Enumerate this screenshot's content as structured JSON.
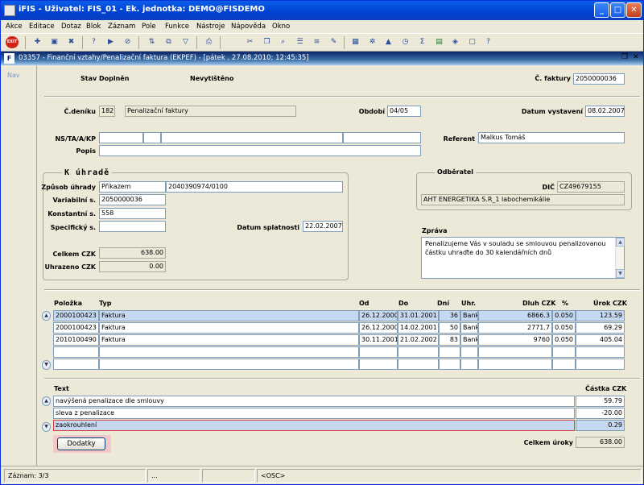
{
  "window": {
    "title": "iFIS - Uživatel: FIS_01 - Ek. jednotka: DEMO@FISDEMO",
    "controls": [
      "_",
      "□",
      "✕"
    ]
  },
  "menu": [
    "Akce",
    "Editace",
    "Dotaz",
    "Blok",
    "Záznam",
    "Pole",
    "Funkce",
    "Nástroje",
    "Nápověda",
    "Okno"
  ],
  "toolbar": {
    "exit_label": "EXIT",
    "icons": [
      "new-record-icon",
      "save-icon",
      "delete-record-icon",
      "query-icon",
      "execute-query-icon",
      "cancel-query-icon",
      "sort-icon",
      "duplicate-icon",
      "filter-icon",
      "print-icon",
      "cut-icon",
      "copy-icon",
      "find-icon",
      "list-icon",
      "list-alt-icon",
      "edit-icon",
      "settings-icon",
      "warning-icon",
      "clock-icon",
      "sum-icon",
      "excel-icon",
      "export-icon",
      "form-icon",
      "help-icon"
    ]
  },
  "child_window": {
    "title": "03357 - Finanční vztahy/Penalizační faktura (EKPEF) - [pátek , 27.08.2010; 12:45:35]",
    "controls": [
      "❐",
      "✕"
    ]
  },
  "nav": {
    "label": "Nav"
  },
  "header": {
    "stav_label": "Stav",
    "stav_value": "Doplněn",
    "print_status": "Nevytištěno",
    "faktura_label": "Č. faktury",
    "faktura_value": "2050000036"
  },
  "journal": {
    "cdeniku_label": "Č.deníku",
    "cdeniku_value": "182",
    "cdeniku_desc": "Penalizační faktury",
    "obdobi_label": "Období",
    "obdobi_value": "04/05",
    "datum_vystaveni_label": "Datum vystavení",
    "datum_vystaveni_value": "08.02.2007",
    "ns_label": "NS/TA/A/KP",
    "referent_label": "Referent",
    "referent_value": "Malkus Tomáš",
    "popis_label": "Popis",
    "popis_value": ""
  },
  "k_uhrade": {
    "title": "K úhradě",
    "zpusob_label": "Způsob úhrady",
    "zpusob_value": "Příkazem",
    "ucet_value": "2040390974/0100",
    "variabilni_label": "Variabilní s.",
    "variabilni_value": "2050000036",
    "konstantni_label": "Konstantní s.",
    "konstantni_value": "558",
    "specificky_label": "Specifický s.",
    "specificky_value": "",
    "splatnost_label": "Datum splatnosti",
    "splatnost_value": "22.02.2007",
    "celkem_label": "Celkem CZK",
    "celkem_value": "638.00",
    "uhrazeno_label": "Uhrazeno CZK",
    "uhrazeno_value": "0.00"
  },
  "odberatel": {
    "title": "Odběratel",
    "dic_label": "DIČ",
    "dic_value": "CZ49679155",
    "name": "AHT ENERGETIKA S.R_1 labochemikálie"
  },
  "zprava": {
    "label": "Zpráva",
    "text": "Penalizujeme Vás v souladu se smlouvou penalizovanou částku uhraďte do 30 kalendářních dnů"
  },
  "items": {
    "headers": [
      "Položka",
      "Typ",
      "Od",
      "Do",
      "Dní",
      "Uhr.",
      "Dluh CZK",
      "%",
      "Úrok CZK"
    ],
    "rows": [
      [
        "2000100423",
        "Faktura",
        "26.12.2000",
        "31.01.2001",
        "36",
        "Bank",
        "6866.3",
        "0.050",
        "123.59"
      ],
      [
        "2000100423",
        "Faktura",
        "26.12.2000",
        "14.02.2001",
        "50",
        "Bank",
        "2771.7",
        "0.050",
        "69.29"
      ],
      [
        "2010100490",
        "Faktura",
        "30.11.2001",
        "21.02.2002",
        "83",
        "Bank",
        "9760",
        "0.050",
        "405.04"
      ],
      [
        "",
        "",
        "",
        "",
        "",
        "",
        "",
        "",
        ""
      ],
      [
        "",
        "",
        "",
        "",
        "",
        "",
        "",
        "",
        ""
      ]
    ]
  },
  "texts": {
    "text_header": "Text",
    "castka_header": "Částka CZK",
    "rows": [
      {
        "text": "navýšená penalizace dle smlouvy",
        "amount": "59.79"
      },
      {
        "text": "sleva z penalizace",
        "amount": "-20.00"
      },
      {
        "text": "zaokrouhlení",
        "amount": "0.29"
      }
    ],
    "dodatky_label": "Dodatky",
    "celkem_uroky_label": "Celkem úroky",
    "celkem_uroky_value": "638.00"
  },
  "status": {
    "zaznam": "Záznam: 3/3",
    "p2": "...",
    "p3": "",
    "mode": "<OSC>"
  },
  "colors": {
    "title_bar": "#0141d0",
    "child_title": "#0a246a",
    "selected_row": "#c6d9f0",
    "highlight_button": "#f4c8c8"
  }
}
